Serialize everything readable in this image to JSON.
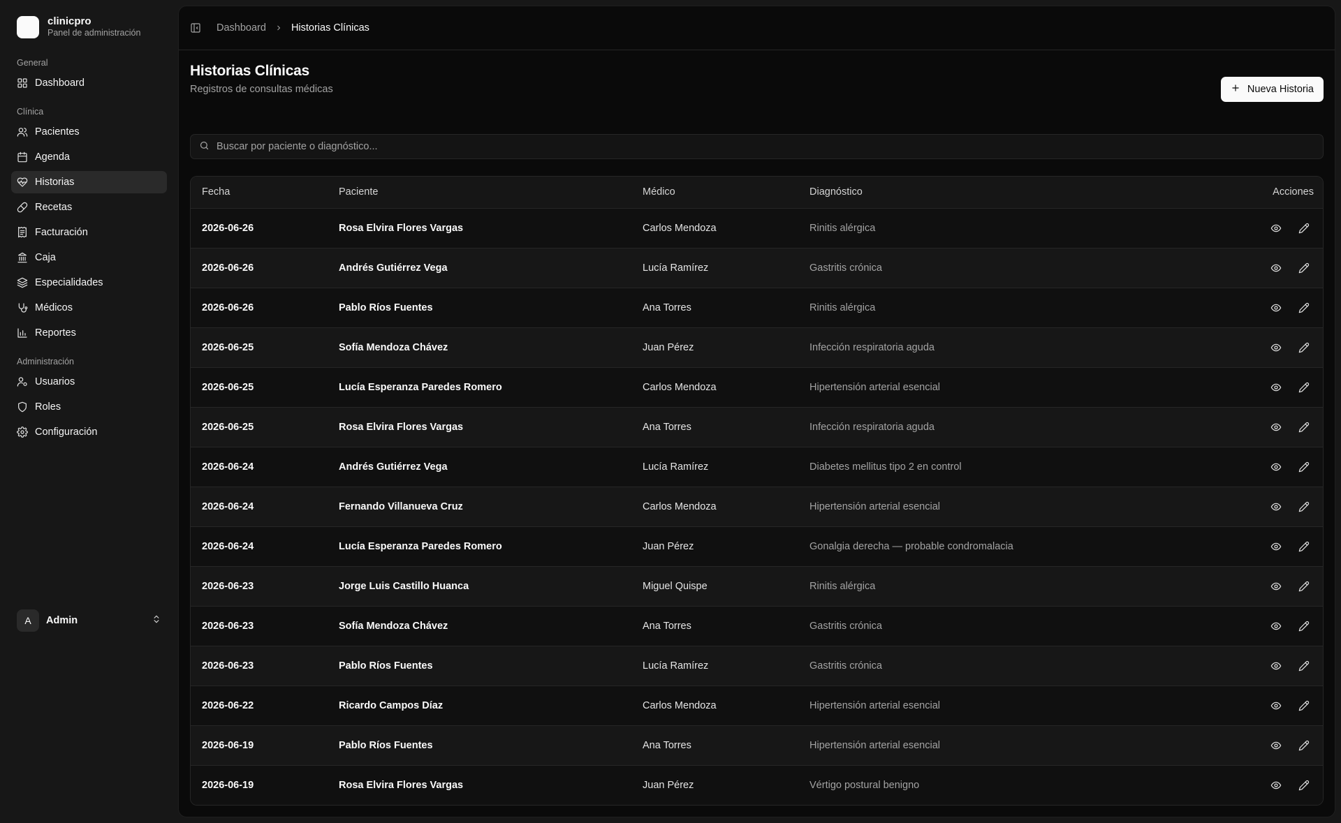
{
  "brand": {
    "name": "clinicpro",
    "subtitle": "Panel de administración"
  },
  "sidebar": {
    "groups": [
      {
        "label": "General",
        "items": [
          {
            "label": "Dashboard",
            "icon": "grid-icon"
          }
        ]
      },
      {
        "label": "Clínica",
        "items": [
          {
            "label": "Pacientes",
            "icon": "users-icon"
          },
          {
            "label": "Agenda",
            "icon": "calendar-icon"
          },
          {
            "label": "Historias",
            "icon": "heart-pulse-icon",
            "active": true
          },
          {
            "label": "Recetas",
            "icon": "pill-icon"
          },
          {
            "label": "Facturación",
            "icon": "receipt-icon"
          },
          {
            "label": "Caja",
            "icon": "landmark-icon"
          },
          {
            "label": "Especialidades",
            "icon": "layers-icon"
          },
          {
            "label": "Médicos",
            "icon": "stethoscope-icon"
          },
          {
            "label": "Reportes",
            "icon": "bar-chart-icon"
          }
        ]
      },
      {
        "label": "Administración",
        "items": [
          {
            "label": "Usuarios",
            "icon": "user-cog-icon"
          },
          {
            "label": "Roles",
            "icon": "shield-icon"
          },
          {
            "label": "Configuración",
            "icon": "gear-icon"
          }
        ]
      }
    ],
    "user": {
      "initial": "A",
      "name": "Admin"
    }
  },
  "breadcrumb": {
    "parent": "Dashboard",
    "current": "Historias Clínicas"
  },
  "page": {
    "title": "Historias Clínicas",
    "subtitle": "Registros de consultas médicas",
    "new_button": "Nueva Historia"
  },
  "search": {
    "placeholder": "Buscar por paciente o diagnóstico...",
    "value": ""
  },
  "table": {
    "headers": {
      "date": "Fecha",
      "patient": "Paciente",
      "doctor": "Médico",
      "diagnosis": "Diagnóstico",
      "actions": "Acciones"
    },
    "rows": [
      {
        "date": "2026-06-26",
        "patient": "Rosa Elvira Flores Vargas",
        "doctor": "Carlos Mendoza",
        "diagnosis": "Rinitis alérgica"
      },
      {
        "date": "2026-06-26",
        "patient": "Andrés Gutiérrez Vega",
        "doctor": "Lucía Ramírez",
        "diagnosis": "Gastritis crónica"
      },
      {
        "date": "2026-06-26",
        "patient": "Pablo Ríos Fuentes",
        "doctor": "Ana Torres",
        "diagnosis": "Rinitis alérgica"
      },
      {
        "date": "2026-06-25",
        "patient": "Sofía Mendoza Chávez",
        "doctor": "Juan Pérez",
        "diagnosis": "Infección respiratoria aguda"
      },
      {
        "date": "2026-06-25",
        "patient": "Lucía Esperanza Paredes Romero",
        "doctor": "Carlos Mendoza",
        "diagnosis": "Hipertensión arterial esencial"
      },
      {
        "date": "2026-06-25",
        "patient": "Rosa Elvira Flores Vargas",
        "doctor": "Ana Torres",
        "diagnosis": "Infección respiratoria aguda"
      },
      {
        "date": "2026-06-24",
        "patient": "Andrés Gutiérrez Vega",
        "doctor": "Lucía Ramírez",
        "diagnosis": "Diabetes mellitus tipo 2 en control"
      },
      {
        "date": "2026-06-24",
        "patient": "Fernando Villanueva Cruz",
        "doctor": "Carlos Mendoza",
        "diagnosis": "Hipertensión arterial esencial"
      },
      {
        "date": "2026-06-24",
        "patient": "Lucía Esperanza Paredes Romero",
        "doctor": "Juan Pérez",
        "diagnosis": "Gonalgia derecha — probable condromalacia"
      },
      {
        "date": "2026-06-23",
        "patient": "Jorge Luis Castillo Huanca",
        "doctor": "Miguel Quispe",
        "diagnosis": "Rinitis alérgica"
      },
      {
        "date": "2026-06-23",
        "patient": "Sofía Mendoza Chávez",
        "doctor": "Ana Torres",
        "diagnosis": "Gastritis crónica"
      },
      {
        "date": "2026-06-23",
        "patient": "Pablo Ríos Fuentes",
        "doctor": "Lucía Ramírez",
        "diagnosis": "Gastritis crónica"
      },
      {
        "date": "2026-06-22",
        "patient": "Ricardo Campos Díaz",
        "doctor": "Carlos Mendoza",
        "diagnosis": "Hipertensión arterial esencial"
      },
      {
        "date": "2026-06-19",
        "patient": "Pablo Ríos Fuentes",
        "doctor": "Ana Torres",
        "diagnosis": "Hipertensión arterial esencial"
      },
      {
        "date": "2026-06-19",
        "patient": "Rosa Elvira Flores Vargas",
        "doctor": "Juan Pérez",
        "diagnosis": "Vértigo postural benigno"
      }
    ],
    "row_actions": [
      {
        "icon": "eye-icon"
      },
      {
        "icon": "pencil-icon"
      }
    ]
  },
  "colors": {
    "background": "#0a0a0a",
    "sidebar": "#171717",
    "accent": "#fafafa",
    "muted_text": "#a3a3a3",
    "border": "#262626"
  }
}
